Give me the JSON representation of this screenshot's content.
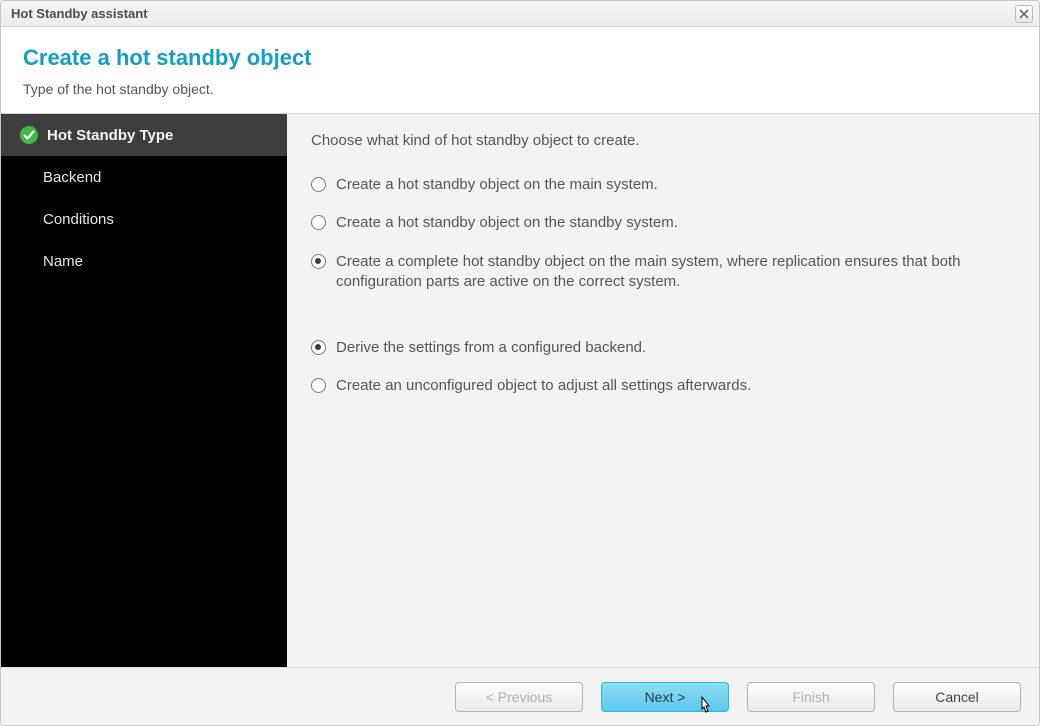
{
  "window": {
    "title": "Hot Standby assistant"
  },
  "header": {
    "title": "Create a hot standby object",
    "subtitle": "Type of the hot standby object."
  },
  "sidebar": {
    "items": [
      {
        "label": "Hot Standby Type",
        "state": "active-done"
      },
      {
        "label": "Backend",
        "state": "pending"
      },
      {
        "label": "Conditions",
        "state": "pending"
      },
      {
        "label": "Name",
        "state": "pending"
      }
    ]
  },
  "content": {
    "instruction": "Choose what kind of hot standby object to create.",
    "group1": {
      "options": [
        {
          "label": "Create a hot standby object on the main system.",
          "selected": false
        },
        {
          "label": "Create a hot standby object on the standby system.",
          "selected": false
        },
        {
          "label": "Create a complete hot standby object on the main system, where replication ensures that both configuration parts are active on the correct system.",
          "selected": true
        }
      ]
    },
    "group2": {
      "options": [
        {
          "label": "Derive the settings from a configured backend.",
          "selected": true
        },
        {
          "label": "Create an unconfigured object to adjust all settings afterwards.",
          "selected": false
        }
      ]
    }
  },
  "footer": {
    "previous": "< Previous",
    "next": "Next >",
    "finish": "Finish",
    "cancel": "Cancel"
  }
}
